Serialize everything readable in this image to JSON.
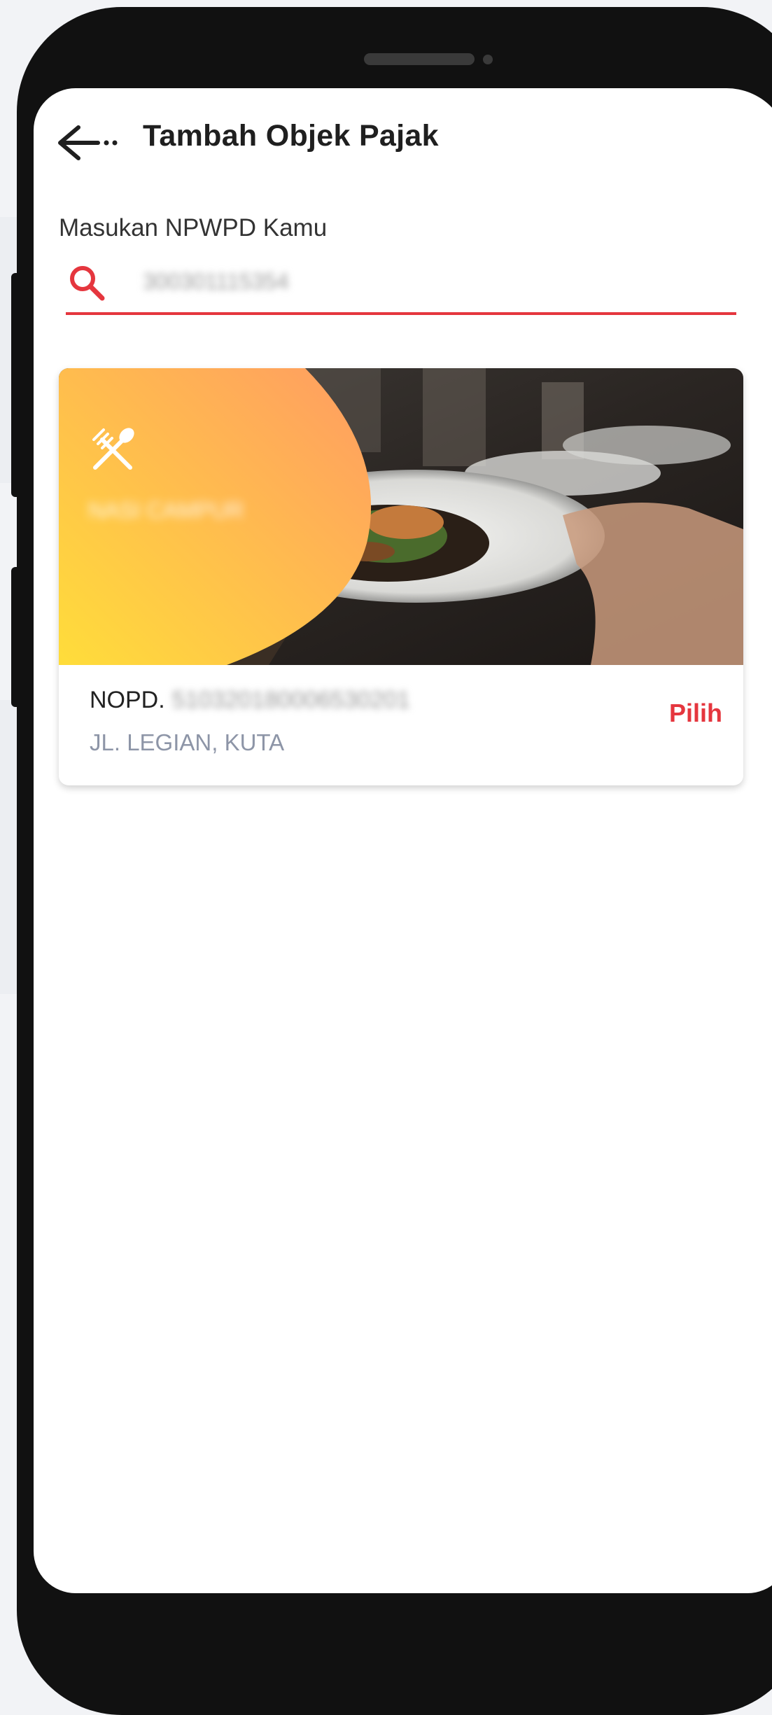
{
  "header": {
    "title": "Tambah Objek Pajak",
    "back_icon": "arrow-left-icon"
  },
  "form": {
    "label": "Masukan NPWPD Kamu",
    "search_icon": "search-icon",
    "npwpd_value": "300301115354"
  },
  "result_card": {
    "category_icon": "fork-spoon-icon",
    "category_name": "NASI CAMPUR",
    "nopd_label": "NOPD.",
    "nopd_value": "510320180006530201",
    "address": "JL. LEGIAN, KUTA",
    "action_label": "Pilih"
  },
  "colors": {
    "accent": "#e5363e",
    "title": "#1f1f1f",
    "address": "#8d95a7",
    "badge_gradient_start": "#ffdd3a",
    "badge_gradient_end": "#ff9c62"
  }
}
